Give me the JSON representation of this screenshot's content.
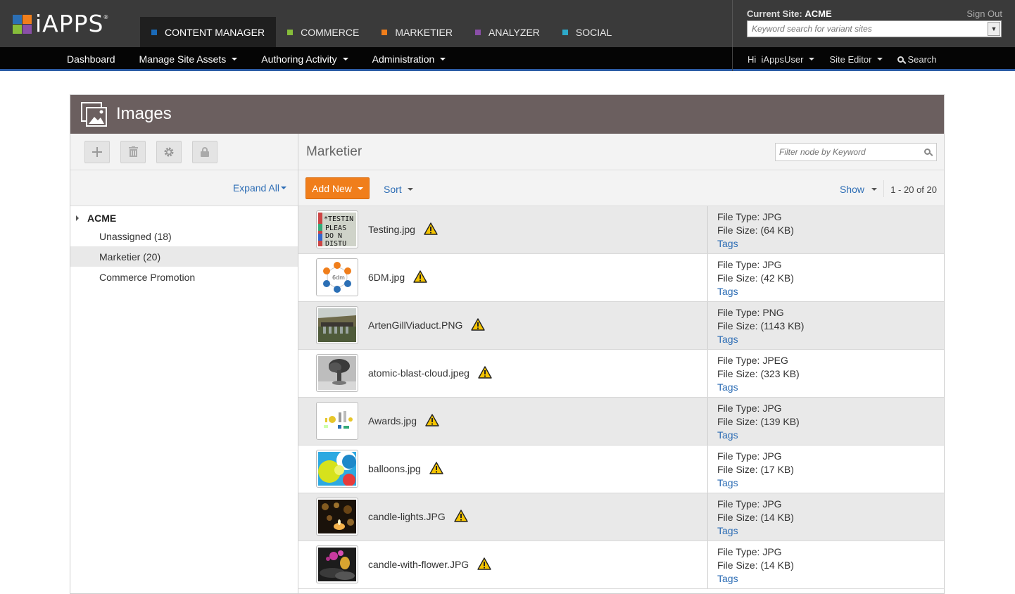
{
  "brand": {
    "logo_text": "iAPPS",
    "logo_mark": "®",
    "colors": {
      "blue": "#2b6fb5",
      "orange": "#f07e1b",
      "green": "#86bd3a",
      "purple": "#8a4fa7"
    }
  },
  "app_tabs": [
    {
      "label": "CONTENT MANAGER",
      "color": "#1a6ab8",
      "active": true
    },
    {
      "label": "COMMERCE",
      "color": "#86bd3a",
      "active": false
    },
    {
      "label": "MARKETIER",
      "color": "#f07e1b",
      "active": false
    },
    {
      "label": "ANALYZER",
      "color": "#8a4fa7",
      "active": false
    },
    {
      "label": "SOCIAL",
      "color": "#2da9c9",
      "active": false
    }
  ],
  "site": {
    "current_label": "Current Site:",
    "current_name": "ACME",
    "sign_out": "Sign Out",
    "variant_search_placeholder": "Keyword search for variant sites"
  },
  "nav": {
    "items": [
      "Dashboard",
      "Manage Site Assets",
      "Authoring Activity",
      "Administration"
    ],
    "user_greeting": "Hi",
    "user_name": "iAppsUser",
    "site_editor": "Site Editor",
    "search": "Search"
  },
  "panel": {
    "title": "Images",
    "toolbar_icons": [
      "plus-icon",
      "trash-icon",
      "gear-icon",
      "lock-icon"
    ],
    "expand_all": "Expand All",
    "tree": {
      "root": "ACME",
      "nodes": [
        {
          "label": "Unassigned (18)",
          "selected": false
        },
        {
          "label": "Marketier (20)",
          "selected": true
        },
        {
          "label": "Commerce Promotion",
          "selected": false
        }
      ]
    },
    "folder_name": "Marketier",
    "filter_placeholder": "Filter node by Keyword",
    "add_new": "Add New",
    "sort": "Sort",
    "show": "Show",
    "paging": "1 - 20 of 20",
    "meta_labels": {
      "type": "File Type:",
      "size": "File Size:",
      "tags": "Tags"
    },
    "files": [
      {
        "name": "Testing.jpg",
        "type": "JPG",
        "size": "(64 KB)",
        "thumb": "testing",
        "warning": true
      },
      {
        "name": "6DM.jpg",
        "type": "JPG",
        "size": "(42 KB)",
        "thumb": "6dm",
        "warning": true
      },
      {
        "name": "ArtenGillViaduct.PNG",
        "type": "PNG",
        "size": "(1143 KB)",
        "thumb": "viaduct",
        "warning": true
      },
      {
        "name": "atomic-blast-cloud.jpeg",
        "type": "JPEG",
        "size": "(323 KB)",
        "thumb": "blast",
        "warning": true
      },
      {
        "name": "Awards.jpg",
        "type": "JPG",
        "size": "(139 KB)",
        "thumb": "awards",
        "warning": true
      },
      {
        "name": "balloons.jpg",
        "type": "JPG",
        "size": "(17 KB)",
        "thumb": "balloons",
        "warning": true
      },
      {
        "name": "candle-lights.JPG",
        "type": "JPG",
        "size": "(14 KB)",
        "thumb": "candles",
        "warning": true
      },
      {
        "name": "candle-with-flower.JPG",
        "type": "JPG",
        "size": "(14 KB)",
        "thumb": "flower",
        "warning": true
      }
    ]
  }
}
